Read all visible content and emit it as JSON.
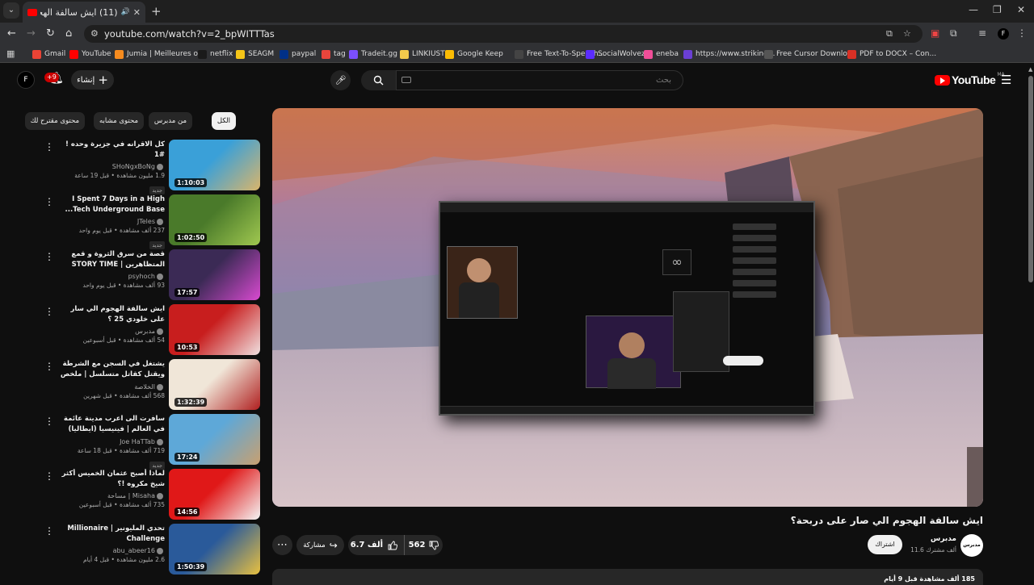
{
  "browser": {
    "tab_title": "(11) ايش سالفة الهجوم الي ح",
    "url": "youtube.com/watch?v=2_bpWITTTas",
    "bookmarks": [
      {
        "label": "Gmail",
        "color": "#ea4335"
      },
      {
        "label": "YouTube",
        "color": "#ff0000"
      },
      {
        "label": "Jumia | Meilleures o...",
        "color": "#f68b1e"
      },
      {
        "label": "netflix",
        "color": "#1a1a1a"
      },
      {
        "label": "SEAGM",
        "color": "#f5c518"
      },
      {
        "label": "paypal",
        "color": "#003087"
      },
      {
        "label": "tag",
        "color": "#e8453c"
      },
      {
        "label": "Tradeit.gg",
        "color": "#7b4fff"
      },
      {
        "label": "LINKIUST",
        "color": "#f2c94c"
      },
      {
        "label": "Google Keep",
        "color": "#fbbc04"
      },
      {
        "label": "Free Text-To-Speech...",
        "color": "#444444"
      },
      {
        "label": "SocialWolvez",
        "color": "#5b2dff"
      },
      {
        "label": "eneba",
        "color": "#f04e98"
      },
      {
        "label": "https://www.striking...",
        "color": "#6a3fd4"
      },
      {
        "label": "Free Cursor Downlo...",
        "color": "#555555"
      },
      {
        "label": "PDF to DOCX – Con...",
        "color": "#d93025"
      }
    ]
  },
  "header": {
    "avatar_letter": "F",
    "notif_count": "+9",
    "create_label": "إنشاء",
    "search_placeholder": "بحث",
    "logo_word": "YouTube",
    "logo_country": "MA"
  },
  "chips": [
    "الكل",
    "من مدبرس",
    "محتوى مشابه",
    "محتوى مقترح لك"
  ],
  "recommendations": [
    {
      "title": "كل الاقرانه في جزيرة وحده ! #1",
      "channel": "SHoNgxBoNg",
      "stats": "1.9 مليون مشاهدة • قبل 19 ساعة",
      "badge": "جديد",
      "duration": "1:10:03",
      "thumb_a": "#3aa0d8",
      "thumb_b": "#d9b56b"
    },
    {
      "title": "I Spent 7 Days in a High Tech Underground Base...",
      "channel": "JTeles",
      "stats": "237 ألف مشاهدة • قبل يوم واحد",
      "badge": "جديد",
      "duration": "1:02:50",
      "thumb_a": "#4a7a2a",
      "thumb_b": "#a0c850"
    },
    {
      "title": "قصة من سرق الثروة و قمع المتظاهرين | STORY TIME",
      "channel": "psyhoch",
      "stats": "93 ألف مشاهدة • قبل يوم واحد",
      "badge": "",
      "duration": "17:57",
      "thumb_a": "#3b2a55",
      "thumb_b": "#d84ad0"
    },
    {
      "title": "ايش سالفة الهجوم الي سار على خلودي 25 ؟",
      "channel": "مدبرس",
      "stats": "54 ألف مشاهدة • قبل أسبوعين",
      "badge": "",
      "duration": "10:53",
      "thumb_a": "#c81e1e",
      "thumb_b": "#f0e0e0"
    },
    {
      "title": "يشتغل في السجن مع الشرطة ويقتل كقاتل متسلسل | ملخص مسلسل dexter الموسم ...",
      "channel": "الخلاصة",
      "stats": "568 ألف مشاهدة • قبل شهرين",
      "badge": "",
      "duration": "1:32:39",
      "thumb_a": "#f0e6d8",
      "thumb_b": "#b02020"
    },
    {
      "title": "سافرت الى اعرب مدينة عائمة في العالم | فينيسيا (ايطاليا) 🇮🇹",
      "channel": "Joe HaTTab",
      "stats": "719 ألف مشاهدة • قبل 18 ساعة",
      "badge": "جديد",
      "duration": "17:24",
      "thumb_a": "#5ea8d8",
      "thumb_b": "#c8a070"
    },
    {
      "title": "لماذا أصبح عثمان الخميس أكثر شيخ مكروه !؟",
      "channel": "Misaha | مساحة",
      "stats": "735 ألف مشاهدة • قبل أسبوعين",
      "badge": "",
      "duration": "14:56",
      "thumb_a": "#e01818",
      "thumb_b": "#f4f4f4"
    },
    {
      "title": "تحدي المليونير | Millionaire Challenge",
      "channel": "abu_abeer16",
      "stats": "2.6 مليون مشاهدة • قبل 4 أيام",
      "badge": "",
      "duration": "1:50:39",
      "thumb_a": "#2a5a9a",
      "thumb_b": "#e8c040"
    }
  ],
  "video": {
    "title": "ايش سالفة الهجوم الي صار على دربحة؟",
    "channel": "مدبرس",
    "channel_avatar_text": "مدبرس",
    "subscribers": "11.6 ألف مشترك",
    "subscribe_label": "اشتراك",
    "likes": "6.7 ألف",
    "dislikes": "562",
    "share_label": "مشاركة",
    "description_stats": "185 ألف مشاهدة قبل 9 أيام"
  }
}
